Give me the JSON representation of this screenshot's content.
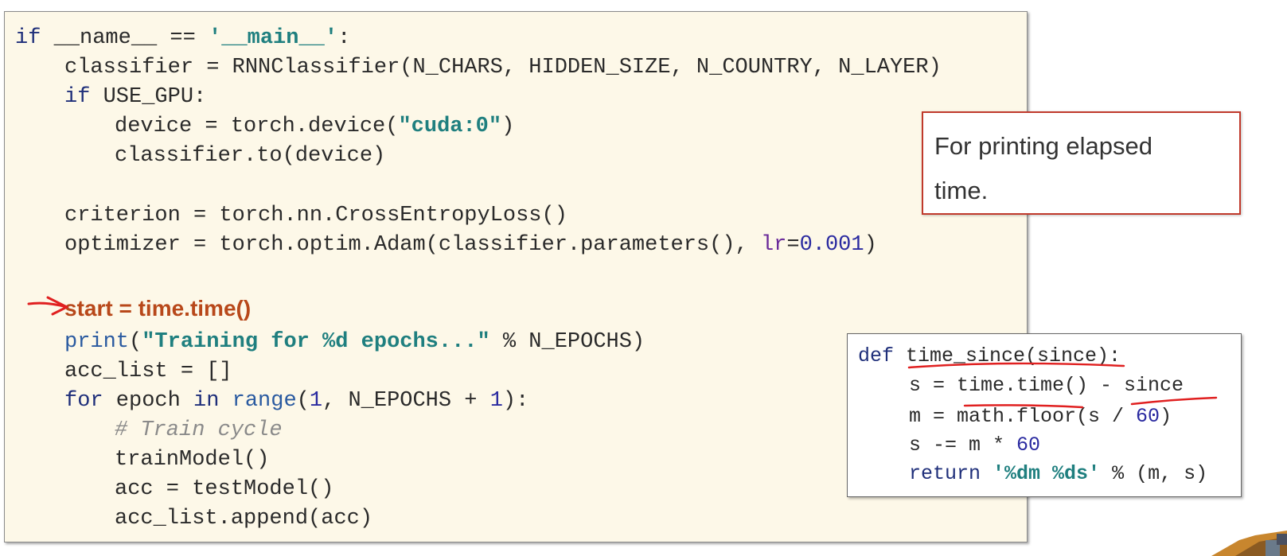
{
  "main_code": {
    "line1": {
      "kw": "if",
      "rest": " __name__ == ",
      "str": "'__main__'",
      "end": ":"
    },
    "line2": "classifier = RNNClassifier(N_CHARS, HIDDEN_SIZE, N_COUNTRY, N_LAYER)",
    "line3": {
      "kw": "if",
      "rest": " USE_GPU:"
    },
    "line4": {
      "pre": "device = torch.device(",
      "str": "\"cuda:0\"",
      "end": ")"
    },
    "line5": "classifier.to(device)",
    "line6": "criterion = torch.nn.CrossEntropyLoss()",
    "line7": {
      "pre": "optimizer = torch.optim.Adam(classifier.parameters(), ",
      "param": "lr",
      "eq": "=",
      "num": "0.001",
      "end": ")"
    },
    "line8": "start = time.time()",
    "line9": {
      "builtin": "print",
      "open": "(",
      "str": "\"Training for %d epochs...\"",
      "end": " % N_EPOCHS)"
    },
    "line10": "acc_list = []",
    "line11": {
      "kw1": "for",
      "mid1": " epoch ",
      "kw2": "in",
      "sp": " ",
      "builtin": "range",
      "open": "(",
      "num1": "1",
      "mid2": ", N_EPOCHS + ",
      "num2": "1",
      "end": "):"
    },
    "line12": "# Train cycle",
    "line13": "trainModel()",
    "line14": "acc = testModel()",
    "line15": "acc_list.append(acc)"
  },
  "callout": {
    "text_line1": "For printing elapsed",
    "text_line2": "time."
  },
  "helper_code": {
    "line1": {
      "kw": "def",
      "rest": " time_since(since):"
    },
    "line2": "s = time.time() - since",
    "line3": {
      "pre": "m = math.floor(s / ",
      "num": "60",
      "end": ")"
    },
    "line4": {
      "pre": "s -= m * ",
      "num": "60"
    },
    "line5": {
      "kw": "return",
      "sp": " ",
      "str": "'%dm %ds'",
      "end": " % (m, s)"
    }
  },
  "colors": {
    "code_bg": "#fdf8e8",
    "keyword": "#1f2f7a",
    "string": "#1f7f7f",
    "highlight": "#b8481a",
    "annotation_red": "#e02020",
    "callout_border": "#c0392b"
  }
}
